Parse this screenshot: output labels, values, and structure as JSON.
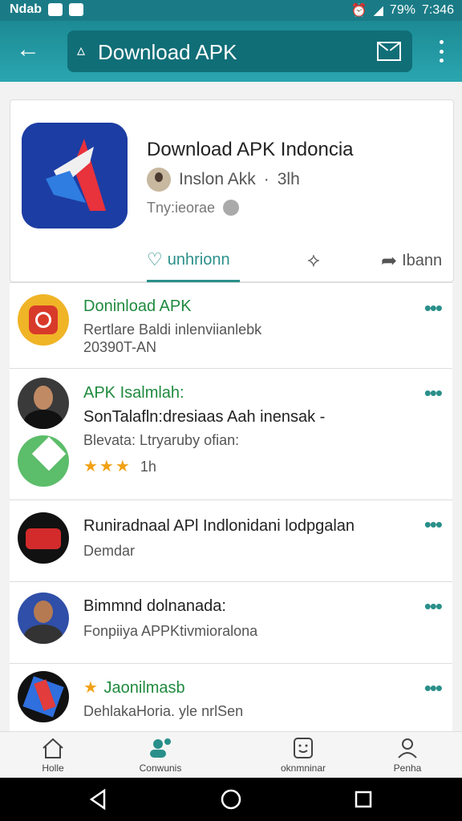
{
  "status_bar": {
    "left_text": "Ndab",
    "right_text": "79%",
    "time": "7:346"
  },
  "toolbar": {
    "search_value": "Download APK",
    "back_icon": "arrow-left-icon",
    "mail_icon": "mail-icon",
    "menu_icon": "more-vert-icon"
  },
  "app_card": {
    "title": "Download APK Indoncia",
    "developer": "Inslon Akk",
    "time": "3lh",
    "tag": "Tny:ieorae",
    "tabs": [
      {
        "label": "unhrionn",
        "icon": "heart-icon"
      },
      {
        "label": "",
        "icon": "share-alt-icon"
      },
      {
        "label": "Ibann",
        "icon": "share-icon"
      }
    ]
  },
  "list": [
    {
      "title": "Doninload APK",
      "subtitle": "Rertlare Baldi inlenviianlebk",
      "line3": "20390T-AN"
    },
    {
      "title": "APK Isalmlah:",
      "subtitle": "SonTalafln:dresiaas Aah inensak -",
      "line3": "Blevata: Ltryaruby ofian:",
      "stars": "★★★",
      "time": "1h"
    },
    {
      "title": "Runiradnaal APl Indlonidani lodpgalan",
      "subtitle": "Demdar"
    },
    {
      "title": "Bimmnd dolnanada:",
      "subtitle": "Fonpiiya APPKtivmioralona"
    },
    {
      "title": "Jaonilmasb",
      "subtitle": "DehlakaHoria. yle nrlSen"
    }
  ],
  "bottom_nav": [
    {
      "label": "Holle",
      "icon": "home-icon"
    },
    {
      "label": "Conwunis",
      "icon": "people-icon"
    },
    {
      "label": "oknmninar",
      "icon": "face-icon"
    },
    {
      "label": "Penha",
      "icon": "person-icon"
    }
  ],
  "colors": {
    "teal": "#2aa6b0",
    "accent_green": "#1f8a3e",
    "star": "#f2a114"
  }
}
